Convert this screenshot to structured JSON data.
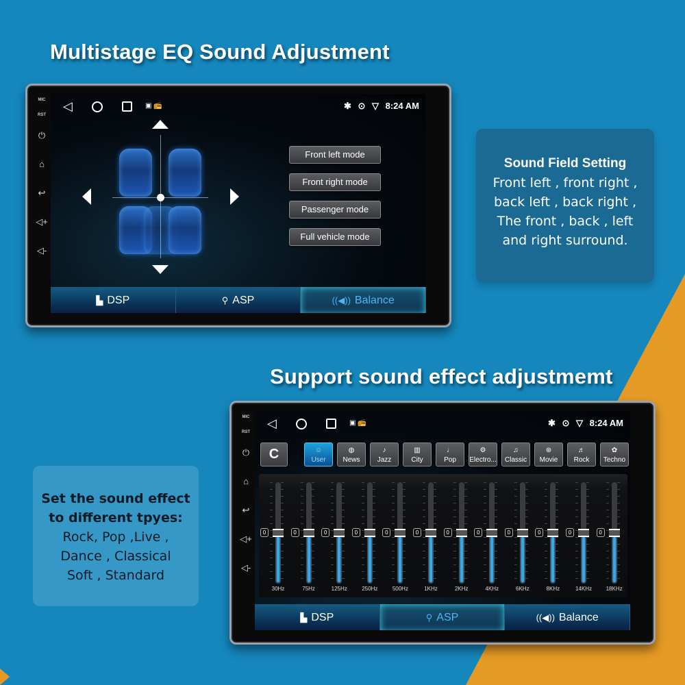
{
  "headlines": {
    "top": "Multistage EQ Sound Adjustment",
    "bottom": "Support sound effect adjustmemt"
  },
  "info_right": {
    "title": "Sound Field Setting",
    "lines": [
      "Front left , front right ,",
      "back left , back right ,",
      "The front , back , left",
      "and right surround."
    ]
  },
  "info_left": {
    "title_lines": [
      "Set the sound effect",
      "to different tpyes:"
    ],
    "lines": [
      "Rock, Pop ,Live ,",
      "Dance , Classical",
      "Soft , Standard"
    ]
  },
  "device": {
    "side_labels": [
      "MIC",
      "RST"
    ],
    "side_keys": [
      "power-icon",
      "home-icon",
      "back-icon",
      "volume-up-icon",
      "volume-down-icon"
    ],
    "side_key_glyphs": [
      "⏻",
      "⌂",
      "↩",
      "◁+",
      "◁-"
    ],
    "status": {
      "time": "8:24 AM",
      "icons": [
        "bluetooth-icon",
        "location-icon",
        "wifi-icon"
      ],
      "glyphs": {
        "back": "◁",
        "bluetooth": "✱",
        "location": "⊙",
        "wifi": "▽",
        "gallery": "▣",
        "radio": "📻"
      }
    }
  },
  "screen1": {
    "modes": [
      "Front left mode",
      "Front right mode",
      "Passenger mode",
      "Full vehicle mode"
    ],
    "tabs": [
      {
        "label": "DSP",
        "icon": "equalizer-bars-icon",
        "glyph": "▙",
        "active": false
      },
      {
        "label": "ASP",
        "icon": "sliders-icon",
        "glyph": "⚲",
        "active": false
      },
      {
        "label": "Balance",
        "icon": "speaker-icon",
        "glyph": "((◀))",
        "active": true
      }
    ]
  },
  "screen2": {
    "reset_glyph": "C",
    "presets": [
      {
        "label": "User",
        "icon": "user-icon",
        "glyph": "☺",
        "active": true
      },
      {
        "label": "News",
        "icon": "news-globe-icon",
        "glyph": "◍",
        "active": false
      },
      {
        "label": "Jazz",
        "icon": "saxophone-icon",
        "glyph": "♪",
        "active": false
      },
      {
        "label": "City",
        "icon": "building-icon",
        "glyph": "▥",
        "active": false
      },
      {
        "label": "Pop",
        "icon": "microphone-icon",
        "glyph": "♩",
        "active": false
      },
      {
        "label": "Electro...",
        "icon": "chip-icon",
        "glyph": "⚙",
        "active": false
      },
      {
        "label": "Classic",
        "icon": "gramophone-icon",
        "glyph": "♫",
        "active": false
      },
      {
        "label": "Movie",
        "icon": "film-reel-icon",
        "glyph": "⊛",
        "active": false
      },
      {
        "label": "Rock",
        "icon": "guitar-icon",
        "glyph": "♬",
        "active": false
      },
      {
        "label": "Techno",
        "icon": "atom-icon",
        "glyph": "✿",
        "active": false
      }
    ],
    "eq_bands": [
      {
        "freq": "30Hz",
        "value": 0
      },
      {
        "freq": "75Hz",
        "value": 0
      },
      {
        "freq": "125Hz",
        "value": 0
      },
      {
        "freq": "250Hz",
        "value": 0
      },
      {
        "freq": "500Hz",
        "value": 0
      },
      {
        "freq": "1KHz",
        "value": 0
      },
      {
        "freq": "2KHz",
        "value": 0
      },
      {
        "freq": "4KHz",
        "value": 0
      },
      {
        "freq": "6KHz",
        "value": 0
      },
      {
        "freq": "8KHz",
        "value": 0
      },
      {
        "freq": "14KHz",
        "value": 0
      },
      {
        "freq": "18KHz",
        "value": 0
      }
    ],
    "eq_range": [
      -12,
      12
    ],
    "tabs": [
      {
        "label": "DSP",
        "icon": "equalizer-bars-icon",
        "glyph": "▙",
        "active": false
      },
      {
        "label": "ASP",
        "icon": "sliders-icon",
        "glyph": "⚲",
        "active": true
      },
      {
        "label": "Balance",
        "icon": "speaker-icon",
        "glyph": "((◀))",
        "active": false
      }
    ]
  },
  "colors": {
    "background_blue": "#1587bd",
    "accent_orange": "#e59a25",
    "active_tab_text": "#4db6f5",
    "eq_fill": "#3aa6e6"
  }
}
